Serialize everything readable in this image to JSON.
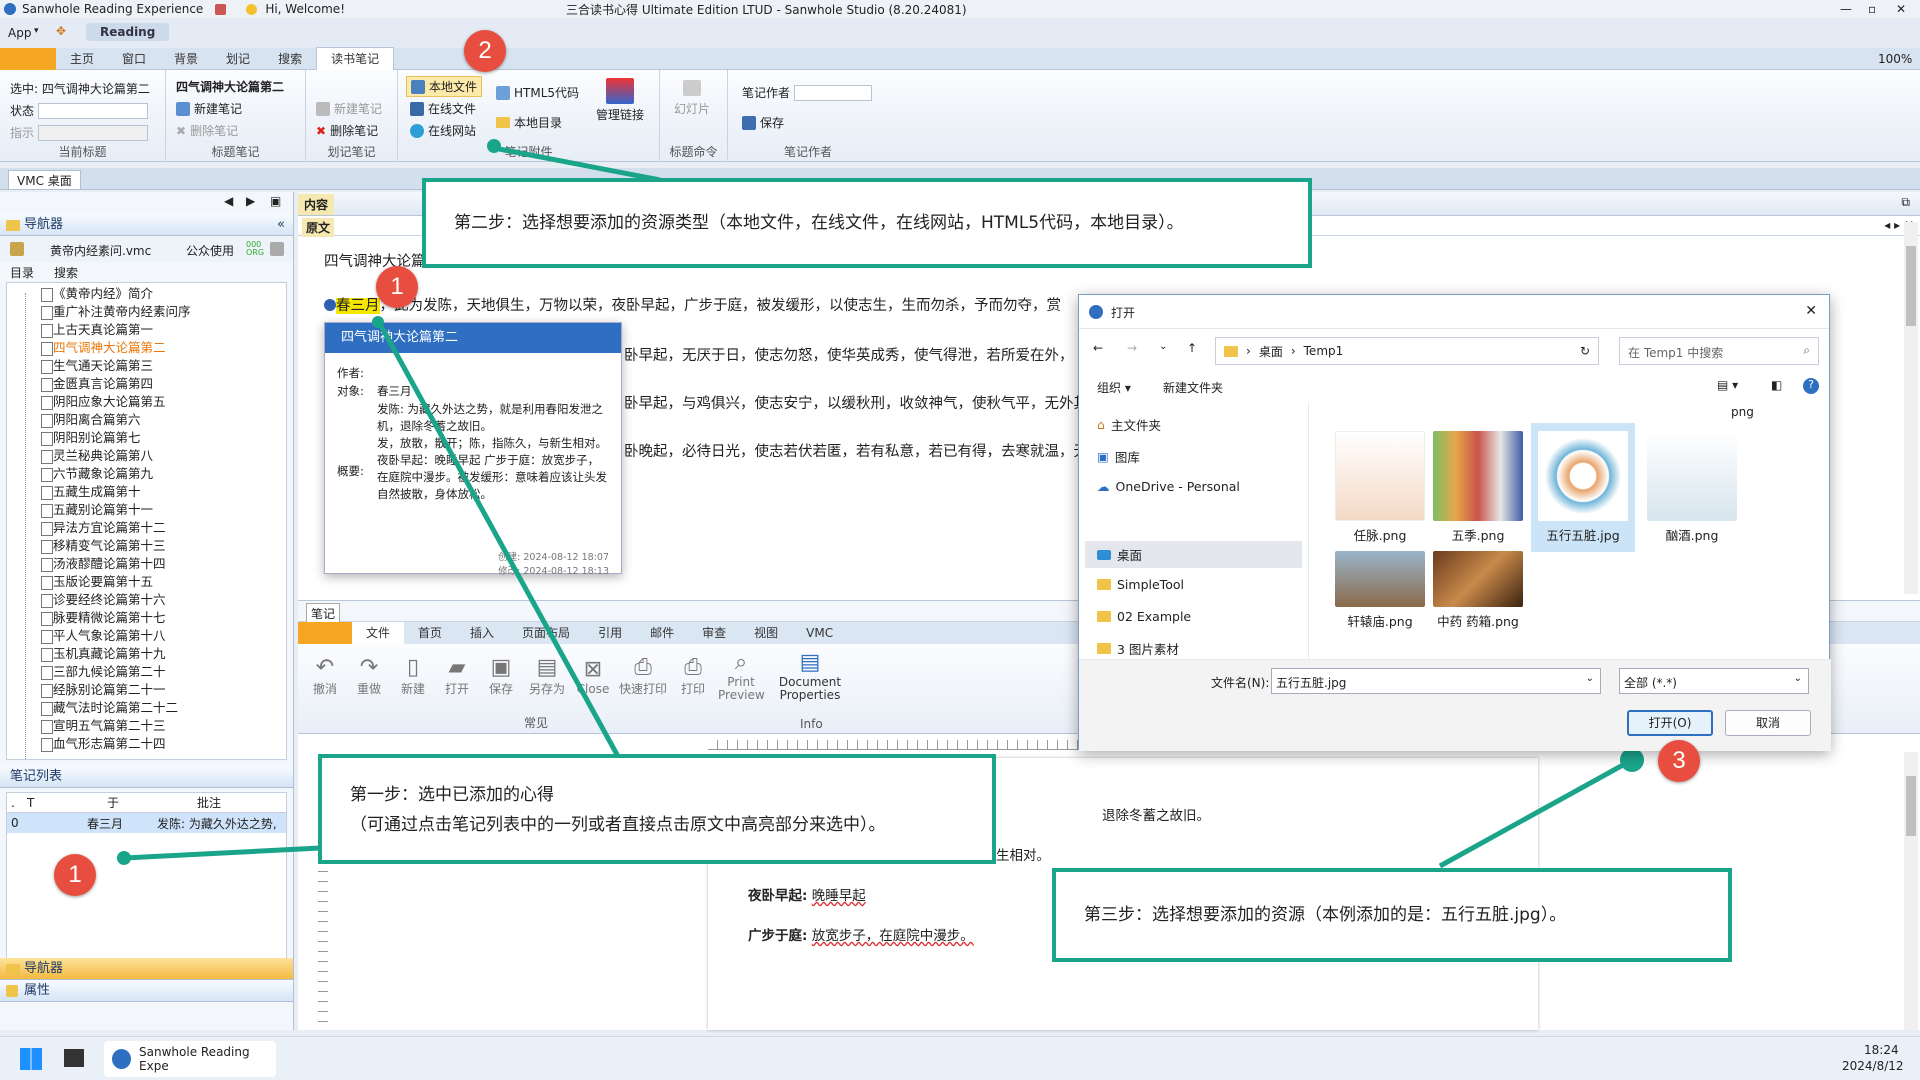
{
  "titlebar": {
    "app_name": "Sanwhole Reading Experience",
    "greeting": "Hi, Welcome!",
    "window_title": "三合读书心得 Ultimate Edition LTUD - Sanwhole Studio (8.20.24081)"
  },
  "menubar": {
    "app": "App",
    "reading": "Reading"
  },
  "ribbon_tabs": [
    "主页",
    "窗口",
    "背景",
    "划记",
    "搜索",
    "读书笔记"
  ],
  "zoom": "100%",
  "ribbon": {
    "current_title": {
      "selected": "选中: 四气调神大论篇第二",
      "status": "状态",
      "indicator": "指示",
      "group": "当前标题"
    },
    "title_notes": {
      "heading": "四气调神大论篇第二",
      "new": "新建笔记",
      "delete": "删除笔记",
      "group": "标题笔记"
    },
    "mark_notes": {
      "new": "新建笔记",
      "delete": "删除笔记",
      "group": "划记笔记"
    },
    "attachments": {
      "local_file": "本地文件",
      "online_file": "在线文件",
      "online_site": "在线网站",
      "html5": "HTML5代码",
      "local_dir": "本地目录",
      "manage": "管理链接",
      "group": "笔记附件"
    },
    "title_cmd": {
      "slide": "幻灯片",
      "group": "标题命令"
    },
    "author": {
      "author_label": "笔记作者",
      "save": "保存",
      "group": "笔记作者"
    }
  },
  "doc_tab": "VMC 桌面",
  "navigator": {
    "title": "导航器",
    "file": "黄帝内经素问.vmc",
    "public_use": "公众使用",
    "tabs": [
      "目录",
      "搜索"
    ],
    "tree": [
      "《黄帝内经》简介",
      "重广补注黄帝内经素问序",
      "上古天真论篇第一",
      "四气调神大论篇第二",
      "生气通天论篇第三",
      "金匮真言论篇第四",
      "阴阳应象大论篇第五",
      "阴阳离合篇第六",
      "阴阳别论篇第七",
      "灵兰秘典论篇第八",
      "六节藏象论篇第九",
      "五藏生成篇第十",
      "五藏别论篇第十一",
      "异法方宜论篇第十二",
      "移精变气论篇第十三",
      "汤液醪醴论篇第十四",
      "玉版论要篇第十五",
      "诊要经终论篇第十六",
      "脉要精微论篇第十七",
      "平人气象论篇第十八",
      "玉机真藏论篇第十九",
      "三部九候论篇第二十",
      "经脉别论篇第二十一",
      "藏气法时论篇第二十二",
      "宣明五气篇第二十三",
      "血气形志篇第二十四"
    ],
    "selected_index": 3
  },
  "note_list": {
    "title": "笔记列表",
    "headers": [
      ".",
      "T",
      "",
      "于",
      "批注"
    ],
    "row": {
      "num": "0",
      "at": "春三月",
      "note": "发陈: 为藏久外达之势,"
    }
  },
  "bottom_panels": {
    "navigator": "导航器",
    "properties": "属性"
  },
  "content": {
    "tab": "内容",
    "source_tab": "原文",
    "heading": "四气调神大论篇第二",
    "highlight": "春三月",
    "lines": [
      "，此为发陈，天地俱生，万物以荣，夜卧早起，广步于庭，被发缓形，以使志生，生而勿杀，予而勿夺，赏",
      "卧早起，无厌于日，使志勿怒，使华英成秀，使气得泄，若所爱在外，",
      "卧早起，与鸡俱兴，使志安宁，以缓秋刑，收敛神气，使秋气平，无外其",
      "卧晚起，必待日光，使志若伏若匿，若有私意，若已有得，去寒就温，无"
    ]
  },
  "popup": {
    "title": "四气调神大论篇第二",
    "author_label": "作者:",
    "object_label": "对象:",
    "object": "春三月",
    "body1": "发陈: 为藏久外达之势，就是利用春阳发泄之机，退除冬蓄之故旧。",
    "body2": "发，放散，散开；陈，指陈久，与新生相对。夜卧早起：晚睡早起 广步于庭：放宽步子，在庭院中漫步。被发缓形：意味着应该让头发自然披散，身体放松。",
    "summary_label": "概要:",
    "created": "创建: 2024-08-12 18:07",
    "modified": "修改: 2024-08-12 18:13"
  },
  "note_editor": {
    "tab": "笔记",
    "tabs": [
      "文件",
      "首页",
      "插入",
      "页面布局",
      "引用",
      "邮件",
      "审查",
      "视图",
      "VMC"
    ],
    "buttons": [
      "撤消",
      "重做",
      "新建",
      "打开",
      "保存",
      "另存为",
      "Close",
      "快速打印",
      "打印",
      "Print Preview",
      "Document Properties"
    ],
    "group_common": "常见",
    "group_info": "Info",
    "doc_lines": [
      "退除冬蓄之故旧。",
      "发，放散，散开；陈，指陈久，与新生相对。"
    ],
    "night": {
      "term": "夜卧早起:",
      "text": "晚睡早起"
    },
    "walk": {
      "term": "广步于庭:",
      "text": "放宽步子，在庭院中漫步。"
    }
  },
  "dialog": {
    "title": "打开",
    "path": [
      "桌面",
      "Temp1"
    ],
    "search_placeholder": "在 Temp1 中搜索",
    "organize": "组织",
    "new_folder": "新建文件夹",
    "sidebar": [
      "主文件夹",
      "图库",
      "OneDrive - Personal",
      "桌面",
      "SimpleTool",
      "02 Example",
      "3 图片素材"
    ],
    "files_row1": [
      "任脉.png",
      "五季.png",
      "五行五脏.jpg",
      "酗酒.png"
    ],
    "files_row2": [
      "轩辕庙.png",
      "中药 药箱.png"
    ],
    "partial_label": "png",
    "filename_label": "文件名(N):",
    "filename_value": "五行五脏.jpg",
    "filter": "全部 (*.*)",
    "open_btn": "打开(O)",
    "cancel_btn": "取消"
  },
  "callouts": {
    "step1": {
      "line1": "第一步：选中已添加的心得",
      "line2": "（可通过点击笔记列表中的一列或者直接点击原文中高亮部分来选中）。"
    },
    "step2": "第二步：选择想要添加的资源类型（本地文件，在线文件，在线网站，HTML5代码，本地目录）。",
    "step3": "第三步：选择想要添加的资源（本例添加的是：五行五脏.jpg）。"
  },
  "badges": [
    "1",
    "2",
    "3"
  ],
  "taskbar": {
    "app": "Sanwhole Reading Expe",
    "time": "18:24",
    "date": "2024/8/12"
  },
  "colors": {
    "accent": "#1aa58b",
    "badge": "#e84e3f",
    "popup_header": "#2f6fc2"
  }
}
